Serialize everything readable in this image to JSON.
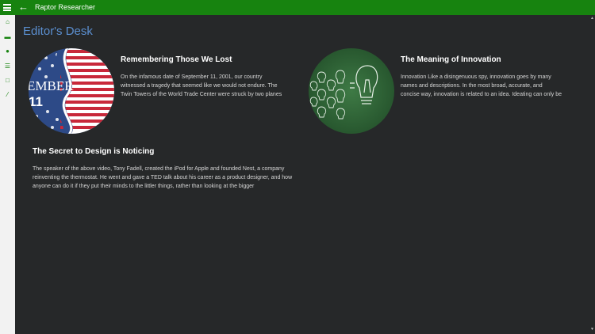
{
  "app": {
    "title": "Raptor Researcher",
    "back_glyph": "←",
    "menu_icon": "hamburger-icon"
  },
  "rail": {
    "items": [
      {
        "icon": "home-icon",
        "glyph": "⌂"
      },
      {
        "icon": "news-icon",
        "glyph": "▬"
      },
      {
        "icon": "people-icon",
        "glyph": "●"
      },
      {
        "icon": "list-icon",
        "glyph": "☰"
      },
      {
        "icon": "document-icon",
        "glyph": "□"
      },
      {
        "icon": "pen-icon",
        "glyph": "⁄"
      }
    ],
    "accent": "#17830f"
  },
  "section": {
    "title": "Editor's Desk"
  },
  "articles": [
    {
      "title": "Remembering Those We Lost",
      "lines": [
        "On the infamous date of September 11, 2001, our country",
        "witnessed a tragedy that seemed like we would not endure. The",
        "Twin Towers of the World Trade Center were struck by two planes"
      ],
      "image_text": "EMBER",
      "image_number": "11"
    },
    {
      "title": "The Meaning of Innovation",
      "lines": [
        "Innovation Like a disingenuous spy, innovation goes by many",
        "names and descriptions. In the most broad, accurate, and",
        "concise way, innovation is related to an idea. Ideating can only be"
      ]
    },
    {
      "title": "The Secret to Design is Noticing",
      "lines": [
        "The speaker of the above video, Tony Fadell, created the iPod for Apple and founded Nest, a company",
        "reinventing the thermostat. He went and gave a TED talk about his career as a product designer, and how",
        "anyone can do it if they put their minds to the littler things, rather than looking at the bigger"
      ]
    }
  ],
  "colors": {
    "titlebar": "#17830f",
    "background": "#262829",
    "heading": "#5b8fd0"
  }
}
